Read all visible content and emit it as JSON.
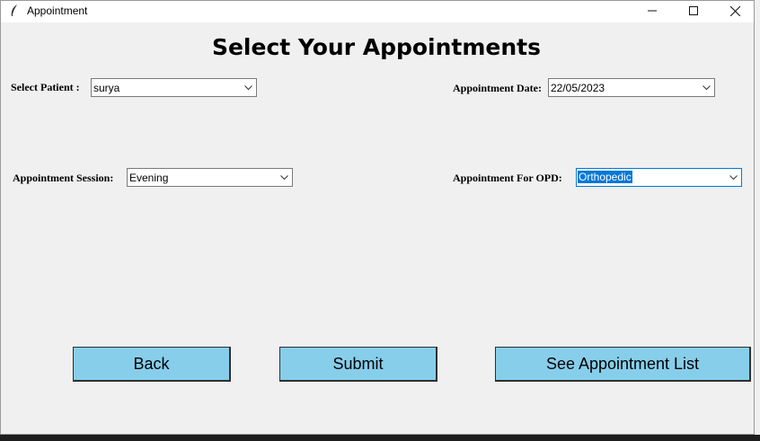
{
  "window": {
    "title": "Appointment",
    "minimize": "—",
    "maximize": "☐",
    "close": "✕"
  },
  "heading": "Select Your Appointments",
  "fields": {
    "patient": {
      "label": "Select Patient :",
      "value": "surya"
    },
    "date": {
      "label": "Appointment Date:",
      "value": "22/05/2023"
    },
    "session": {
      "label": "Appointment Session:",
      "value": "Evening"
    },
    "opd": {
      "label": "Appointment For OPD:",
      "value": "Orthopedic"
    }
  },
  "buttons": {
    "back": "Back",
    "submit": "Submit",
    "list": "See Appointment List"
  },
  "colors": {
    "button_bg": "#87ceeb",
    "selection": "#0078d7"
  }
}
